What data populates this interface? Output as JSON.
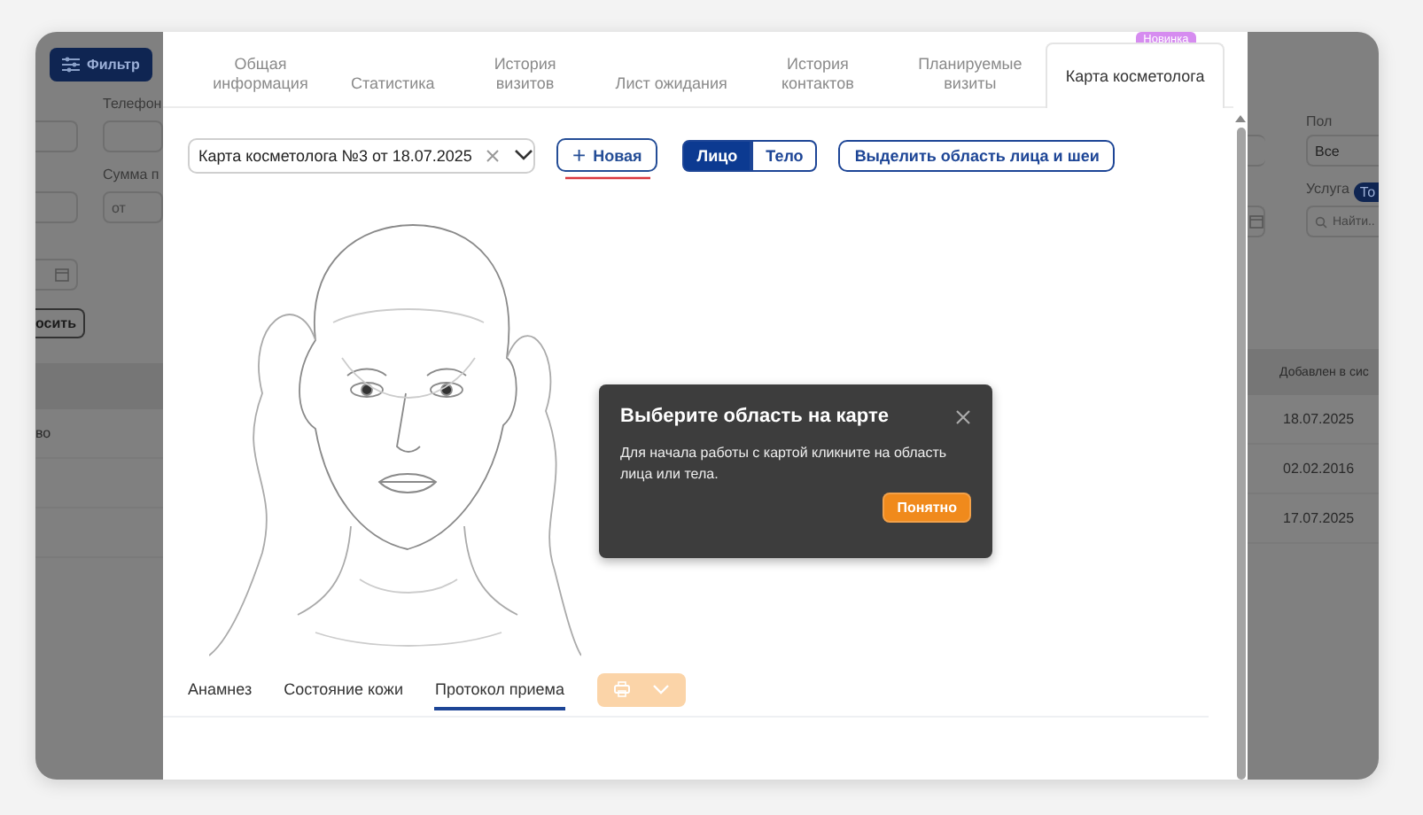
{
  "background_left": {
    "filter_button": "Фильтр",
    "phone_label": "Телефон",
    "sum_label": "Сумма п",
    "sum_from_placeholder": "от",
    "reset_button": "осить",
    "row_text": "во"
  },
  "background_right": {
    "gender_label": "Пол",
    "gender_value": "Все",
    "service_label": "Услуга",
    "service_badge": "То",
    "search_placeholder": "Найти..",
    "column_header": "Добавлен в сис",
    "dates": [
      "18.07.2025",
      "02.02.2016",
      "17.07.2025"
    ]
  },
  "tabs": [
    {
      "label": "Общая информация",
      "selected": false
    },
    {
      "label": "Статистика",
      "selected": false
    },
    {
      "label": "История визитов",
      "selected": false
    },
    {
      "label": "Лист ожидания",
      "selected": false
    },
    {
      "label": "История контактов",
      "selected": false
    },
    {
      "label": "Планируемые визиты",
      "selected": false
    },
    {
      "label": "Карта косметолога",
      "selected": true,
      "badge": "Новинка"
    }
  ],
  "card_select": {
    "value": "Карта косметолога №3 от 18.07.2025"
  },
  "new_button": {
    "icon": "+",
    "label": "Новая"
  },
  "view_toggle": [
    {
      "label": "Лицо",
      "selected": true
    },
    {
      "label": "Тело",
      "selected": false
    }
  ],
  "highlight_button": "Выделить область лица и шеи",
  "popover": {
    "title": "Выберите область на карте",
    "body": "Для начала работы с картой кликните на область лица или тела.",
    "button": "Понятно"
  },
  "bottom_tabs": [
    {
      "label": "Анамнез",
      "selected": false
    },
    {
      "label": "Состояние кожи",
      "selected": false
    },
    {
      "label": "Протокол приема",
      "selected": true
    }
  ],
  "print_button": {
    "disabled": true
  }
}
